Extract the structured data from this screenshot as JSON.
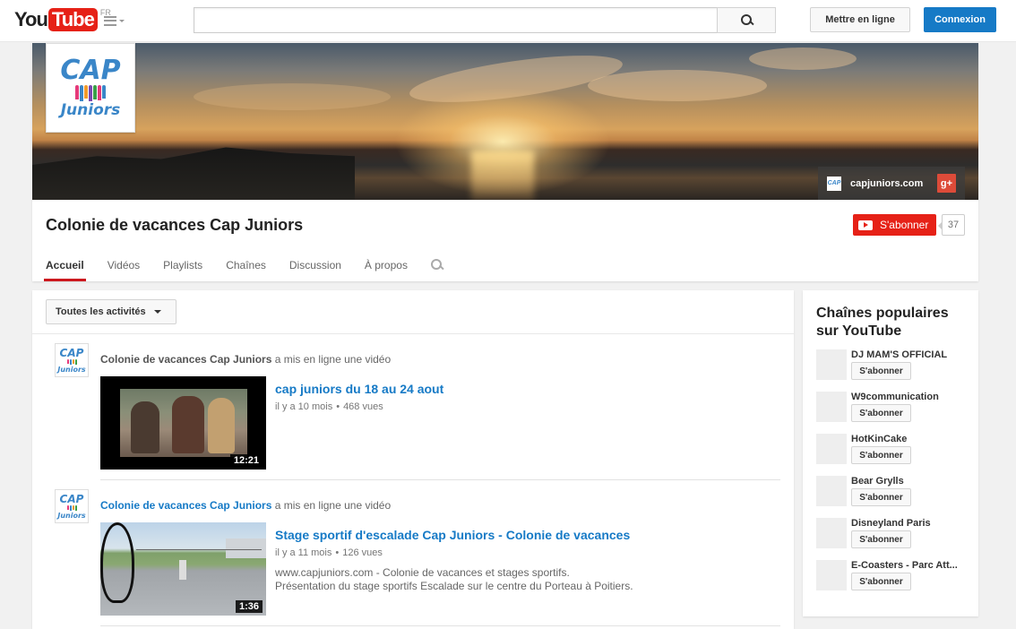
{
  "masthead": {
    "logo_you": "You",
    "logo_tube": "Tube",
    "region": "FR",
    "search_placeholder": "",
    "upload_label": "Mettre en ligne",
    "signin_label": "Connexion"
  },
  "channel": {
    "title": "Colonie de vacances Cap Juniors",
    "avatar_text_top": "CAP",
    "avatar_text_bottom": "Juniors",
    "banner_link_label": "capjuniors.com",
    "gplus_label": "g+",
    "subscribe_label": "S'abonner",
    "subscriber_count": "37",
    "tabs": [
      {
        "label": "Accueil",
        "active": true
      },
      {
        "label": "Vidéos"
      },
      {
        "label": "Playlists"
      },
      {
        "label": "Chaînes"
      },
      {
        "label": "Discussion"
      },
      {
        "label": "À propos"
      }
    ]
  },
  "feed": {
    "filter_label": "Toutes les activités",
    "activities": [
      {
        "author": "Colonie de vacances Cap Juniors",
        "action": " a mis en ligne une vidéo",
        "title": "cap juniors du 18 au 24 aout",
        "age": "il y a 10 mois",
        "views": "468 vues",
        "duration": "12:21",
        "description": ""
      },
      {
        "author": "Colonie de vacances Cap Juniors",
        "action": " a mis en ligne une vidéo",
        "title": "Stage sportif d'escalade Cap Juniors - Colonie de vacances",
        "age": "il y a 11 mois",
        "views": "126 vues",
        "duration": "1:36",
        "description_line1": "www.capjuniors.com - Colonie de vacances et stages sportifs.",
        "description_line2": "Présentation du stage sportifs Escalade sur le centre du Porteau à Poitiers."
      }
    ]
  },
  "sidebar": {
    "title": "Chaînes populaires sur YouTube",
    "subscribe_label": "S'abonner",
    "channels": [
      {
        "name": "DJ MAM'S OFFICIAL"
      },
      {
        "name": "W9communication"
      },
      {
        "name": "HotKinCake"
      },
      {
        "name": "Bear Grylls"
      },
      {
        "name": "Disneyland Paris"
      },
      {
        "name": "E-Coasters - Parc Att..."
      }
    ]
  },
  "colors": {
    "brand_red": "#e62117",
    "link_blue": "#167ac6",
    "tab_underline": "#cc181e"
  }
}
